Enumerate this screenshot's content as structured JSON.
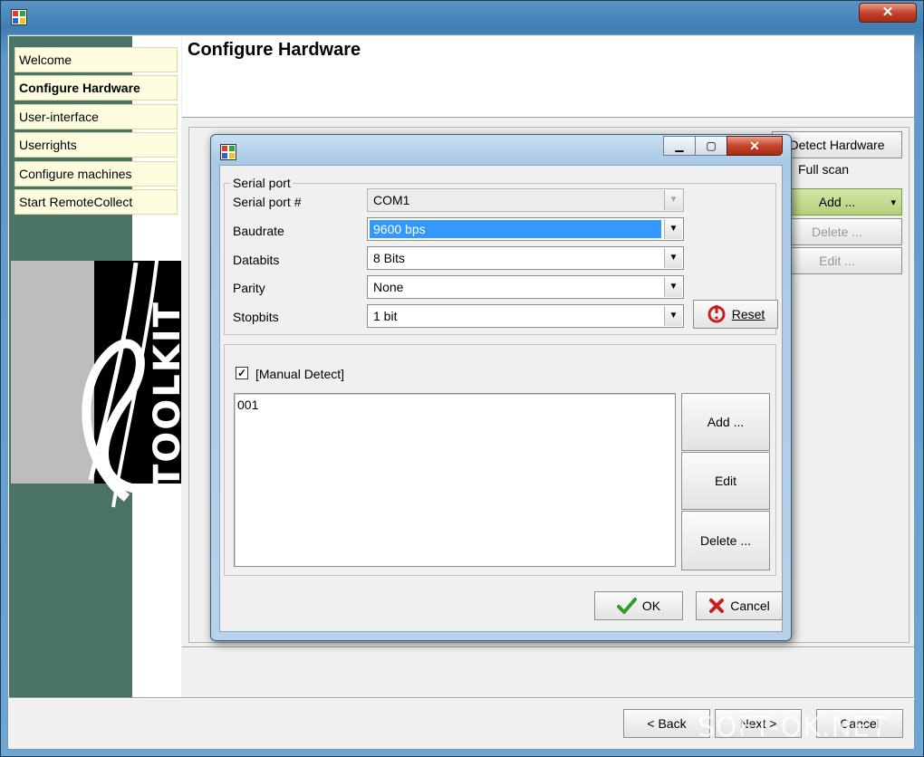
{
  "window": {
    "title": "",
    "close_glyph": "✕"
  },
  "nav": {
    "items": [
      {
        "label": "Welcome"
      },
      {
        "label": "Configure Hardware",
        "active": true
      },
      {
        "label": "User-interface"
      },
      {
        "label": "Userrights"
      },
      {
        "label": "Configure machines"
      },
      {
        "label": "Start RemoteCollect"
      }
    ]
  },
  "brand": {
    "text": "TOOLKIT"
  },
  "page": {
    "title": "Configure Hardware"
  },
  "side_actions": {
    "detect_hardware": "Detect Hardware",
    "full_scan": "Full scan",
    "add": "Add ...",
    "add_arrow": "▾",
    "delete": "Delete  ...",
    "edit": "Edit  ..."
  },
  "footer": {
    "back": "< Back",
    "next": "Next >",
    "cancel": "Cancel"
  },
  "dialog": {
    "caption_buttons": {
      "minimize": "▁",
      "maximize": "▢",
      "close": "✕"
    },
    "serial_port": {
      "legend": "Serial port",
      "fields": [
        {
          "label": "Serial port #",
          "value": "COM1",
          "disabled": true
        },
        {
          "label": "Baudrate",
          "value": "9600 bps",
          "selected": true
        },
        {
          "label": "Databits",
          "value": "8 Bits"
        },
        {
          "label": "Parity",
          "value": "None"
        },
        {
          "label": "Stopbits",
          "value": "1 bit"
        }
      ],
      "arrow": "▼",
      "reset": "Reset"
    },
    "manual_detect": {
      "checked": true,
      "check_glyph": "✓",
      "label": "[Manual Detect]",
      "list_items": [
        "001"
      ],
      "add": "Add ...",
      "edit": "Edit",
      "delete": "Delete ..."
    },
    "ok": "OK",
    "cancel": "Cancel"
  },
  "watermark": "SOFT-OK.NET",
  "colors": {
    "selection": "#3399ff",
    "brand_green": "#4a7366",
    "nav_bg": "#fffde0",
    "add_button": "#b5d07a"
  }
}
